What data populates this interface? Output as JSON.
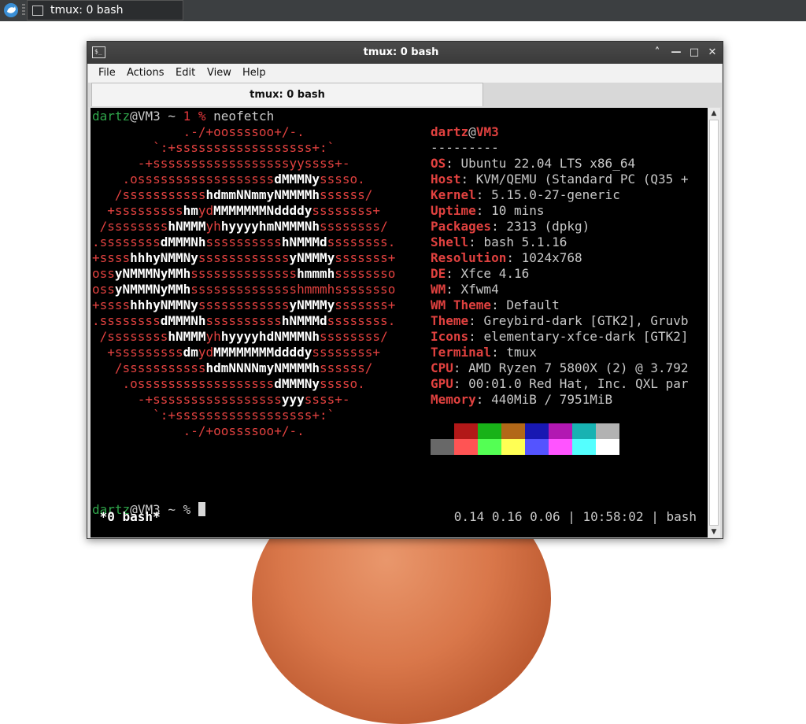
{
  "panel": {
    "launcher_icon": "xfce-mouse-icon",
    "task_label": "tmux: 0 bash"
  },
  "window": {
    "title": "tmux: 0 bash",
    "menu": [
      "File",
      "Actions",
      "Edit",
      "View",
      "Help"
    ],
    "tab_label": "tmux: 0 bash",
    "buttons": {
      "up": "˄",
      "min": "—",
      "max": "□",
      "close": "✕"
    }
  },
  "terminal": {
    "prompt1": {
      "user": "dartz",
      "at": "@",
      "host": "VM3",
      "path": " ~ ",
      "code": "1 %",
      "command": " neofetch"
    },
    "logo": [
      [
        [
          "r",
          "            .-/+oossssoo+/-.               "
        ]
      ],
      [
        [
          "r",
          "        `:+ssssssssssssssssss+:`           "
        ]
      ],
      [
        [
          "r",
          "      -+ssssssssssssssssssyyssss+-         "
        ]
      ],
      [
        [
          "r",
          "    .ossssssssssssssssss"
        ],
        [
          "w",
          "dMMMNy"
        ],
        [
          "r",
          "sssso.       "
        ]
      ],
      [
        [
          "r",
          "   /sssssssssss"
        ],
        [
          "w",
          "hdmmNNmmyNMMMMh"
        ],
        [
          "r",
          "ssssss/      "
        ]
      ],
      [
        [
          "r",
          "  +sssssssss"
        ],
        [
          "w",
          "hm"
        ],
        [
          "r",
          "yd"
        ],
        [
          "w",
          "MMMMMMMNddddy"
        ],
        [
          "r",
          "ssssssss+     "
        ]
      ],
      [
        [
          "r",
          " /ssssssss"
        ],
        [
          "w",
          "hNMMM"
        ],
        [
          "r",
          "yh"
        ],
        [
          "w",
          "hyyyyhmNMMMNh"
        ],
        [
          "r",
          "ssssssss/    "
        ]
      ],
      [
        [
          "r",
          ".ssssssss"
        ],
        [
          "w",
          "dMMMNh"
        ],
        [
          "r",
          "ssssssssss"
        ],
        [
          "w",
          "hNMMMd"
        ],
        [
          "r",
          "ssssssss.    "
        ]
      ],
      [
        [
          "r",
          "+ssss"
        ],
        [
          "w",
          "hhhyNMMNy"
        ],
        [
          "r",
          "ssssssssssss"
        ],
        [
          "w",
          "yNMMMy"
        ],
        [
          "r",
          "sssssss+    "
        ]
      ],
      [
        [
          "r",
          "oss"
        ],
        [
          "w",
          "yNMMMNyMMh"
        ],
        [
          "r",
          "ssssssssssssss"
        ],
        [
          "w",
          "hmmmh"
        ],
        [
          "r",
          "ssssssso    "
        ]
      ],
      [
        [
          "r",
          "oss"
        ],
        [
          "w",
          "yNMMMNyMMh"
        ],
        [
          "r",
          "sssssssssssssshmmmhssssssso    "
        ]
      ],
      [
        [
          "r",
          "+ssss"
        ],
        [
          "w",
          "hhhyNMMNy"
        ],
        [
          "r",
          "ssssssssssss"
        ],
        [
          "w",
          "yNMMMy"
        ],
        [
          "r",
          "sssssss+    "
        ]
      ],
      [
        [
          "r",
          ".ssssssss"
        ],
        [
          "w",
          "dMMMNh"
        ],
        [
          "r",
          "ssssssssss"
        ],
        [
          "w",
          "hNMMMd"
        ],
        [
          "r",
          "ssssssss.    "
        ]
      ],
      [
        [
          "r",
          " /ssssssss"
        ],
        [
          "w",
          "hNMMM"
        ],
        [
          "r",
          "yh"
        ],
        [
          "w",
          "hyyyyhdNMMMNh"
        ],
        [
          "r",
          "ssssssss/    "
        ]
      ],
      [
        [
          "r",
          "  +sssssssss"
        ],
        [
          "w",
          "dm"
        ],
        [
          "r",
          "yd"
        ],
        [
          "w",
          "MMMMMMMMddddy"
        ],
        [
          "r",
          "ssssssss+     "
        ]
      ],
      [
        [
          "r",
          "   /sssssssssss"
        ],
        [
          "w",
          "hdmNNNNmyNMMMMh"
        ],
        [
          "r",
          "ssssss/      "
        ]
      ],
      [
        [
          "r",
          "    .ossssssssssssssssss"
        ],
        [
          "w",
          "dMMMNy"
        ],
        [
          "r",
          "sssso.       "
        ]
      ],
      [
        [
          "r",
          "      -+sssssssssssssssss"
        ],
        [
          "w",
          "yyy"
        ],
        [
          "r",
          "ssss+-         "
        ]
      ],
      [
        [
          "r",
          "        `:+ssssssssssssssssss+:`           "
        ]
      ],
      [
        [
          "r",
          "            .-/+oossssoo+/-.               "
        ]
      ]
    ],
    "info_header": {
      "user": "dartz",
      "at": "@",
      "host": "VM3",
      "divider": "---------"
    },
    "info": [
      {
        "key": "OS",
        "value": "Ubuntu 22.04 LTS x86_64"
      },
      {
        "key": "Host",
        "value": "KVM/QEMU (Standard PC (Q35 +"
      },
      {
        "key": "Kernel",
        "value": "5.15.0-27-generic"
      },
      {
        "key": "Uptime",
        "value": "10 mins"
      },
      {
        "key": "Packages",
        "value": "2313 (dpkg)"
      },
      {
        "key": "Shell",
        "value": "bash 5.1.16"
      },
      {
        "key": "Resolution",
        "value": "1024x768"
      },
      {
        "key": "DE",
        "value": "Xfce 4.16"
      },
      {
        "key": "WM",
        "value": "Xfwm4"
      },
      {
        "key": "WM Theme",
        "value": "Default"
      },
      {
        "key": "Theme",
        "value": "Greybird-dark [GTK2], Gruvb"
      },
      {
        "key": "Icons",
        "value": "elementary-xfce-dark [GTK2]"
      },
      {
        "key": "Terminal",
        "value": "tmux"
      },
      {
        "key": "CPU",
        "value": "AMD Ryzen 7 5800X (2) @ 3.792"
      },
      {
        "key": "GPU",
        "value": "00:01.0 Red Hat, Inc. QXL par"
      },
      {
        "key": "Memory",
        "value": "440MiB / 7951MiB"
      }
    ],
    "palette_row1": [
      "#000000",
      "#b21818",
      "#18b218",
      "#b26818",
      "#1818b2",
      "#b218b2",
      "#18b2b2",
      "#b2b2b2"
    ],
    "palette_row2": [
      "#686868",
      "#ff5454",
      "#54ff54",
      "#ffff54",
      "#5454ff",
      "#ff54ff",
      "#54ffff",
      "#ffffff"
    ],
    "prompt2": {
      "user": "dartz",
      "at": "@",
      "host": "VM3",
      "path": " ~ ",
      "code": "%"
    },
    "status_left": " *0 bash*",
    "status_right": "0.14 0.16 0.06 | 10:58:02 | bash"
  }
}
